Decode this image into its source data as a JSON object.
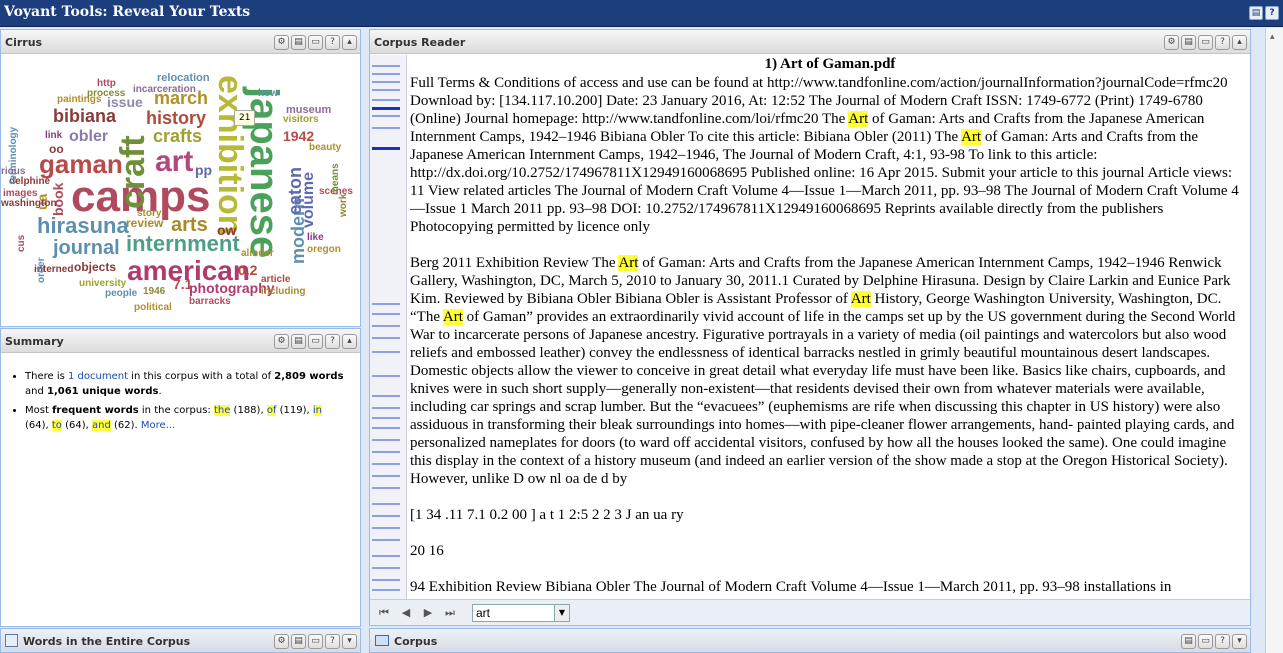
{
  "app": {
    "title": "Voyant Tools: Reveal Your Texts"
  },
  "cirrus": {
    "title": "Cirrus",
    "tooltip": "21",
    "words": [
      {
        "t": "exhibition",
        "c": "#b9b938"
      },
      {
        "t": "japanese",
        "c": "#4ba15a"
      },
      {
        "t": "camps",
        "c": "#b04a5e"
      },
      {
        "t": "craft",
        "c": "#6f8f3a"
      },
      {
        "t": "art",
        "c": "#b04a7e"
      },
      {
        "t": "gaman",
        "c": "#b84a4a"
      },
      {
        "t": "american",
        "c": "#b03a6e"
      },
      {
        "t": "internment",
        "c": "#4f9e8a"
      },
      {
        "t": "hirasuna",
        "c": "#5e8fb0"
      },
      {
        "t": "journal",
        "c": "#5e8fb0"
      },
      {
        "t": "arts",
        "c": "#a98a2a"
      },
      {
        "t": "crafts",
        "c": "#a0a030"
      },
      {
        "t": "history",
        "c": "#b04a3a"
      },
      {
        "t": "march",
        "c": "#b0902a"
      },
      {
        "t": "bibiana",
        "c": "#8a3a3a"
      },
      {
        "t": "obler",
        "c": "#8a7ab0"
      },
      {
        "t": "issue",
        "c": "#8a8ab0"
      },
      {
        "t": "modern",
        "c": "#5e8fb0"
      },
      {
        "t": "eaton",
        "c": "#5e6ab0"
      },
      {
        "t": "volume",
        "c": "#5e6ab0"
      },
      {
        "t": "photography",
        "c": "#b03a6e"
      },
      {
        "t": "objects",
        "c": "#8a3a3a"
      },
      {
        "t": "review",
        "c": "#a98a2a"
      },
      {
        "t": "book",
        "c": "#b04a5e"
      },
      {
        "t": "museum",
        "c": "#8a6a9a"
      },
      {
        "t": "1942",
        "c": "#b84a4a"
      },
      {
        "t": "ua",
        "c": "#b0902a"
      },
      {
        "t": "ow",
        "c": "#8a3a3a"
      },
      {
        "t": "7.1",
        "c": "#b84a4a"
      },
      {
        "t": "0.2",
        "c": "#b04a3a"
      },
      {
        "t": "relocation",
        "c": "#5e8fb0"
      },
      {
        "t": "incarceration",
        "c": "#8a6a9a"
      },
      {
        "t": "paintings",
        "c": "#b0902a"
      },
      {
        "t": "process",
        "c": "#8a8a3a"
      },
      {
        "t": "http",
        "c": "#b04a5e"
      },
      {
        "t": "how",
        "c": "#5e8fb0"
      },
      {
        "t": "link",
        "c": "#8a3a8a"
      },
      {
        "t": "delphine",
        "c": "#8a3a3a"
      },
      {
        "t": "washington",
        "c": "#8a3a3a"
      },
      {
        "t": "images",
        "c": "#b04a5e"
      },
      {
        "t": "interned",
        "c": "#8a3a3a"
      },
      {
        "t": "university",
        "c": "#a0a030"
      },
      {
        "t": "people",
        "c": "#5e8fb0"
      },
      {
        "t": "political",
        "c": "#b0902a"
      },
      {
        "t": "1946",
        "c": "#8a8a3a"
      },
      {
        "t": "barracks",
        "c": "#b04a5e"
      },
      {
        "t": "article",
        "c": "#b04a3a"
      },
      {
        "t": "including",
        "c": "#a98a2a"
      },
      {
        "t": "alinder",
        "c": "#b0902a"
      },
      {
        "t": "story",
        "c": "#a98a2a"
      },
      {
        "t": "beauty",
        "c": "#b0902a"
      },
      {
        "t": "visitors",
        "c": "#a0a030"
      },
      {
        "t": "scenes",
        "c": "#b04a5e"
      },
      {
        "t": "like",
        "c": "#8a3a8a"
      },
      {
        "t": "oregon",
        "c": "#b0902a"
      },
      {
        "t": "work",
        "c": "#8a8a3a"
      },
      {
        "t": "means",
        "c": "#6f8f3a"
      },
      {
        "t": "order",
        "c": "#5e8fb0"
      },
      {
        "t": "terminology",
        "c": "#5e8fb0"
      },
      {
        "t": "rious",
        "c": "#8a6a9a"
      },
      {
        "t": "oo",
        "c": "#8a3a3a"
      },
      {
        "t": "pp",
        "c": "#5e6ab0"
      },
      {
        "t": "cus",
        "c": "#b04a5e"
      }
    ]
  },
  "summary": {
    "title": "Summary",
    "l1_a": "There is ",
    "l1_link": "1 document",
    "l1_b": " in this corpus with a total of ",
    "l1_words": "2,809 words",
    "l1_c": " and ",
    "l1_unique": "1,061 unique words",
    "l1_d": ".",
    "l2_a": "Most ",
    "l2_bold": "frequent words",
    "l2_b": " in the corpus: ",
    "terms": [
      {
        "w": "the",
        "n": " (188), "
      },
      {
        "w": "of",
        "n": " (119), "
      },
      {
        "w": "in",
        "n": " (64), "
      },
      {
        "w": "to",
        "n": " (64), "
      },
      {
        "w": "and",
        "n": " (62). "
      }
    ],
    "more": "More..."
  },
  "bottom_left": {
    "title": "Words in the Entire Corpus"
  },
  "reader": {
    "title": "Corpus Reader",
    "doc_title": "1) Art of Gaman.pdf",
    "search_value": "art",
    "paragraphs": [
      "Full Terms & Conditions of access and use can be found at http://www.tandfonline.com/action/journalInformation?journalCode=rfmc20 Download by: [134.117.10.200] Date: 23 January 2016, At: 12:52 The Journal of Modern Craft ISSN: 1749-6772 (Print) 1749-6780 (Online) Journal homepage: http://www.tandfonline.com/loi/rfmc20 The [[Art]] of Gaman: Arts and Crafts from the Japanese American Internment Camps, 1942–1946 Bibiana Obler To cite this article: Bibiana Obler (2011) The [[Art]] of Gaman: Arts and Crafts from the Japanese American Internment Camps, 1942–1946, The Journal of Modern Craft, 4:1, 93-98 To link to this article: http://dx.doi.org/10.2752/174967811X12949160068695 Published online: 16 Apr 2015. Submit your article to this journal Article views: 11 View related articles The Journal of Modern Craft Volume 4—Issue 1—March 2011, pp. 93–98 The Journal of Modern Craft Volume 4—Issue 1 March 2011 pp. 93–98 DOI: 10.2752/174967811X12949160068695 Reprints available directly from the publishers Photocopying permitted by licence only",
      "Berg 2011 Exhibition Review The [[Art]] of Gaman: Arts and Crafts from the Japanese American Internment Camps, 1942–1946 Renwick Gallery, Washington, DC, March 5, 2010 to January 30, 2011.1 Curated by Delphine Hirasuna. Design by Claire Larkin and Eunice Park Kim. Reviewed by Bibiana Obler Bibiana Obler is Assistant Professor of [[Art]] History, George Washington University, Washington, DC. “The [[Art]] of Gaman” provides an extraordinarily vivid account of life in the camps set up by the US government during the Second World War to incarcerate persons of Japanese ancestry. Figurative portrayals in a variety of media (oil paintings and watercolors but also wood reliefs and embossed leather) convey the endlessness of identical barracks nestled in grimly beautiful mountainous desert landscapes. Domestic objects allow the viewer to conceive in great detail what everyday life must have been like. Basics like chairs, cupboards, and knives were in such short supply—generally non-existent—that residents devised their own from whatever materials were available, including car springs and scrap lumber. But the “evacuees” (euphemisms are rife when discussing this chapter in US history) were also assiduous in transforming their bleak surroundings into homes—with pipe-cleaner flower arrangements, hand- painted playing cards, and personalized nameplates for doors (to ward off accidental visitors, confused by how all the houses looked the same). One could imagine this display in the context of a history museum (and indeed an earlier version of the show made a stop at the Oregon Historical Society). However, unlike D ow nl oa de d by",
      "[1 34 .11 7.1 0.2 00 ] a t 1 2:5 2 2 3 J an ua ry",
      "20 16",
      "94 Exhibition Review Bibiana Obler The Journal of Modern Craft Volume 4—Issue 1—March 2011, pp. 93–98 installations in"
    ]
  },
  "bottom_right": {
    "title": "Corpus"
  }
}
